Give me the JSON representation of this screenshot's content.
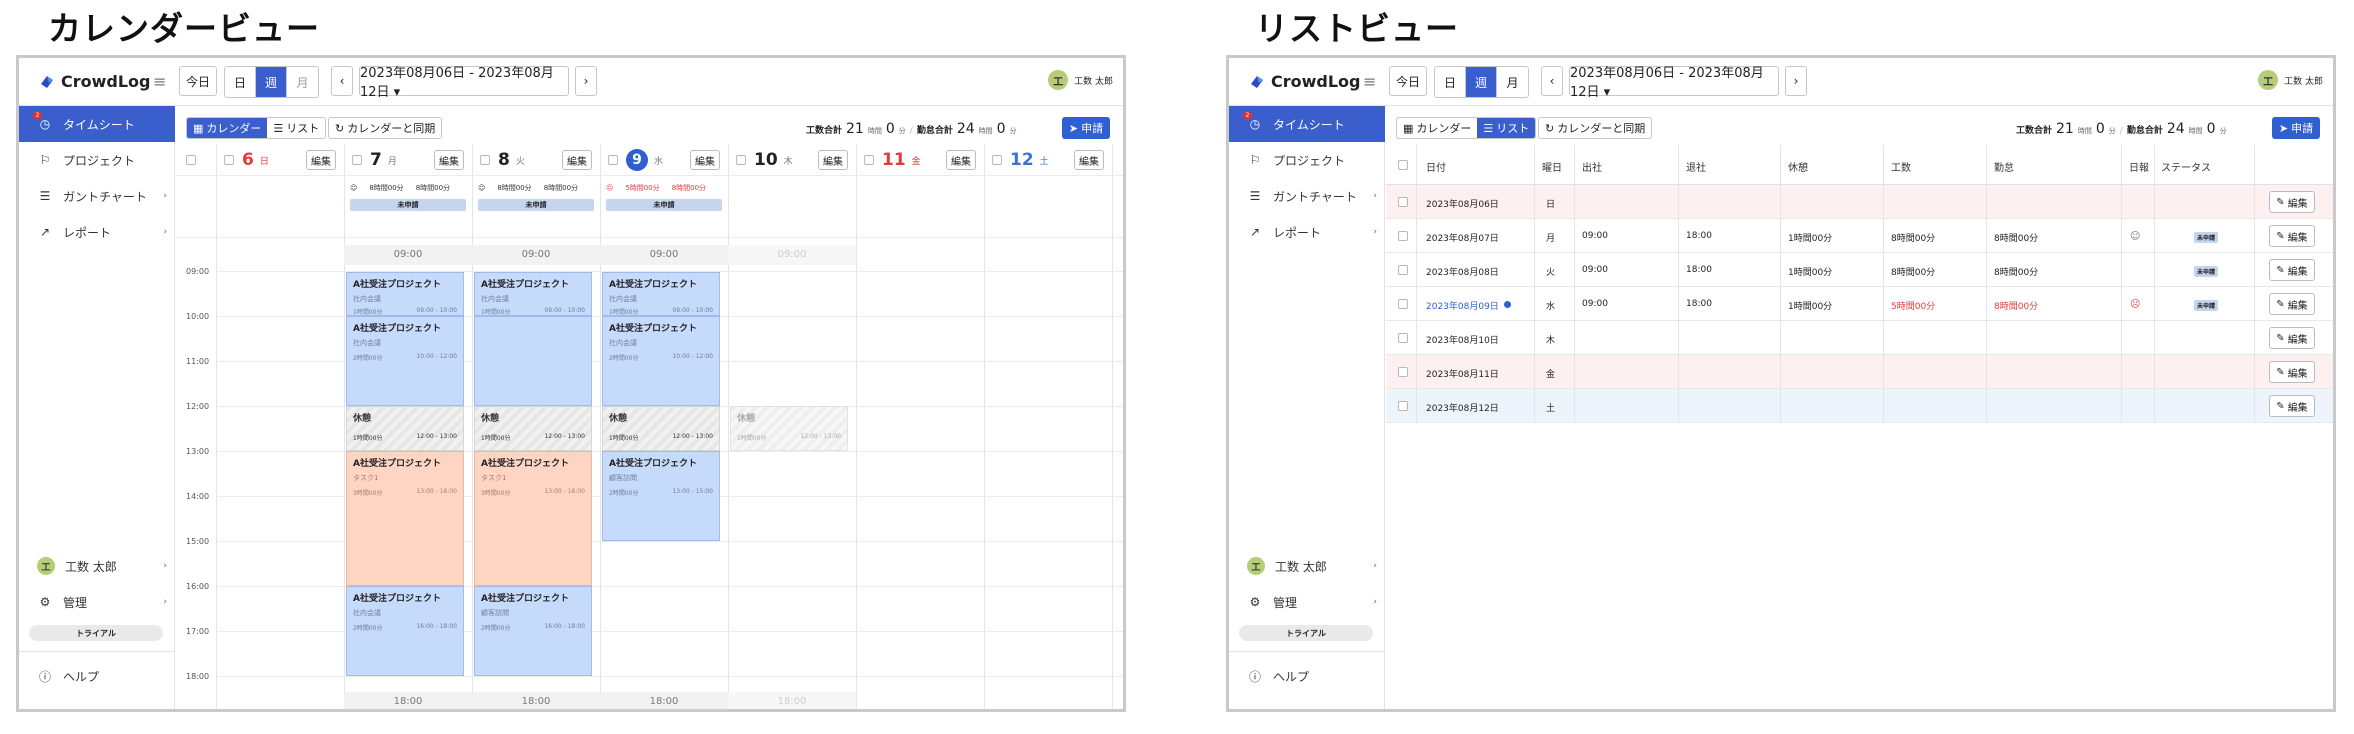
{
  "captions": {
    "calendar": "カレンダービュー",
    "list": "リストビュー"
  },
  "app": {
    "brand": "CrowdLog",
    "today": "今日",
    "modes": [
      "日",
      "週",
      "月"
    ],
    "range": "2023年08月06日 - 2023年08月12日 ▾",
    "user_initial": "工",
    "user_name": "工数 太郎"
  },
  "sidebar": {
    "badge": "2",
    "items": [
      {
        "label": "タイムシート",
        "icon": "clock-icon"
      },
      {
        "label": "プロジェクト",
        "icon": "flag-icon"
      },
      {
        "label": "ガントチャート",
        "icon": "gantt-icon",
        "chevron": "›"
      },
      {
        "label": "レポート",
        "icon": "trend-icon",
        "chevron": "›"
      }
    ],
    "user": "工数 太郎",
    "admin": "管理",
    "trial": "トライアル",
    "help": "ヘルプ"
  },
  "toolbar": {
    "calendar_label": "カレンダー",
    "list_label": "リスト",
    "sync_label": "カレンダーと同期",
    "work_total_label": "工数合計",
    "work_total_h": "21",
    "work_total_m": "0",
    "attend_total_label": "勤怠合計",
    "attend_total_h": "24",
    "attend_total_m": "0",
    "unit_h": "時間",
    "unit_m": "分",
    "apply_label": "申請"
  },
  "calendar": {
    "edit_label": "編集",
    "days": [
      {
        "num": "6",
        "wk": "日",
        "color": "#e03c3c"
      },
      {
        "num": "7",
        "wk": "月",
        "color": "#222222",
        "work": "8時間00分",
        "attend": "8時間00分",
        "status": "未申請"
      },
      {
        "num": "8",
        "wk": "火",
        "color": "#222222",
        "work": "8時間00分",
        "attend": "8時間00分",
        "status": "未申請"
      },
      {
        "num": "9",
        "wk": "水",
        "color": "#ffffff",
        "today": true,
        "work": "5時間00分",
        "attend": "8時間00分",
        "status": "未申請",
        "warn": true
      },
      {
        "num": "10",
        "wk": "木",
        "color": "#222222"
      },
      {
        "num": "11",
        "wk": "金",
        "color": "#e03c3c"
      },
      {
        "num": "12",
        "wk": "土",
        "color": "#3a73d8"
      }
    ],
    "start_time": "09:00",
    "end_time": "18:00",
    "hours": [
      "09:00",
      "10:00",
      "11:00",
      "12:00",
      "13:00",
      "14:00",
      "15:00",
      "16:00",
      "17:00",
      "18:00"
    ],
    "events": {
      "mtg_title": "A社受注プロジェクト",
      "mtg_sub": "社内会議",
      "mtg_dur1": "1時間00分",
      "mtg_range1": "09:00 - 10:00",
      "mtg_dur2": "2時間00分",
      "mtg_range2": "10:00 - 12:00",
      "rest_title": "休憩",
      "rest_dur": "1時間00分",
      "rest_range": "12:00 - 13:00",
      "task_sub": "タスク1",
      "task_dur": "3時間00分",
      "task_range": "13:00 - 16:00",
      "visit_sub": "顧客訪問",
      "visit_dur": "2時間00分",
      "visit_range": "13:00 - 15:00",
      "pm_dur": "2時間00分",
      "pm_range": "16:00 - 18:00"
    }
  },
  "list": {
    "headers": [
      "日付",
      "曜日",
      "出社",
      "退社",
      "休憩",
      "工数",
      "勤怠",
      "日報",
      "ステータス"
    ],
    "edit_label": "編集",
    "rows": [
      {
        "date": "2023年08月06日",
        "wk": "日",
        "in": "",
        "out": "",
        "rest": "",
        "work": "",
        "attend": "",
        "status": "",
        "bg": "#fdf0f0"
      },
      {
        "date": "2023年08月07日",
        "wk": "月",
        "in": "09:00",
        "out": "18:00",
        "rest": "1時間00分",
        "work": "8時間00分",
        "attend": "8時間00分",
        "status": "未申請",
        "bg": "#ffffff"
      },
      {
        "date": "2023年08月08日",
        "wk": "火",
        "in": "09:00",
        "out": "18:00",
        "rest": "1時間00分",
        "work": "8時間00分",
        "attend": "8時間00分",
        "status": "未申請",
        "bg": "#ffffff"
      },
      {
        "date": "2023年08月09日",
        "wk": "水",
        "in": "09:00",
        "out": "18:00",
        "rest": "1時間00分",
        "work": "5時間00分",
        "attend": "8時間00分",
        "status": "未申請",
        "bg": "#ffffff",
        "today": true
      },
      {
        "date": "2023年08月10日",
        "wk": "木",
        "in": "",
        "out": "",
        "rest": "",
        "work": "",
        "attend": "",
        "status": "",
        "bg": "#ffffff"
      },
      {
        "date": "2023年08月11日",
        "wk": "金",
        "in": "",
        "out": "",
        "rest": "",
        "work": "",
        "attend": "",
        "status": "",
        "bg": "#fdf0f0"
      },
      {
        "date": "2023年08月12日",
        "wk": "土",
        "in": "",
        "out": "",
        "rest": "",
        "work": "",
        "attend": "",
        "status": "",
        "bg": "#eef4fb"
      }
    ]
  }
}
